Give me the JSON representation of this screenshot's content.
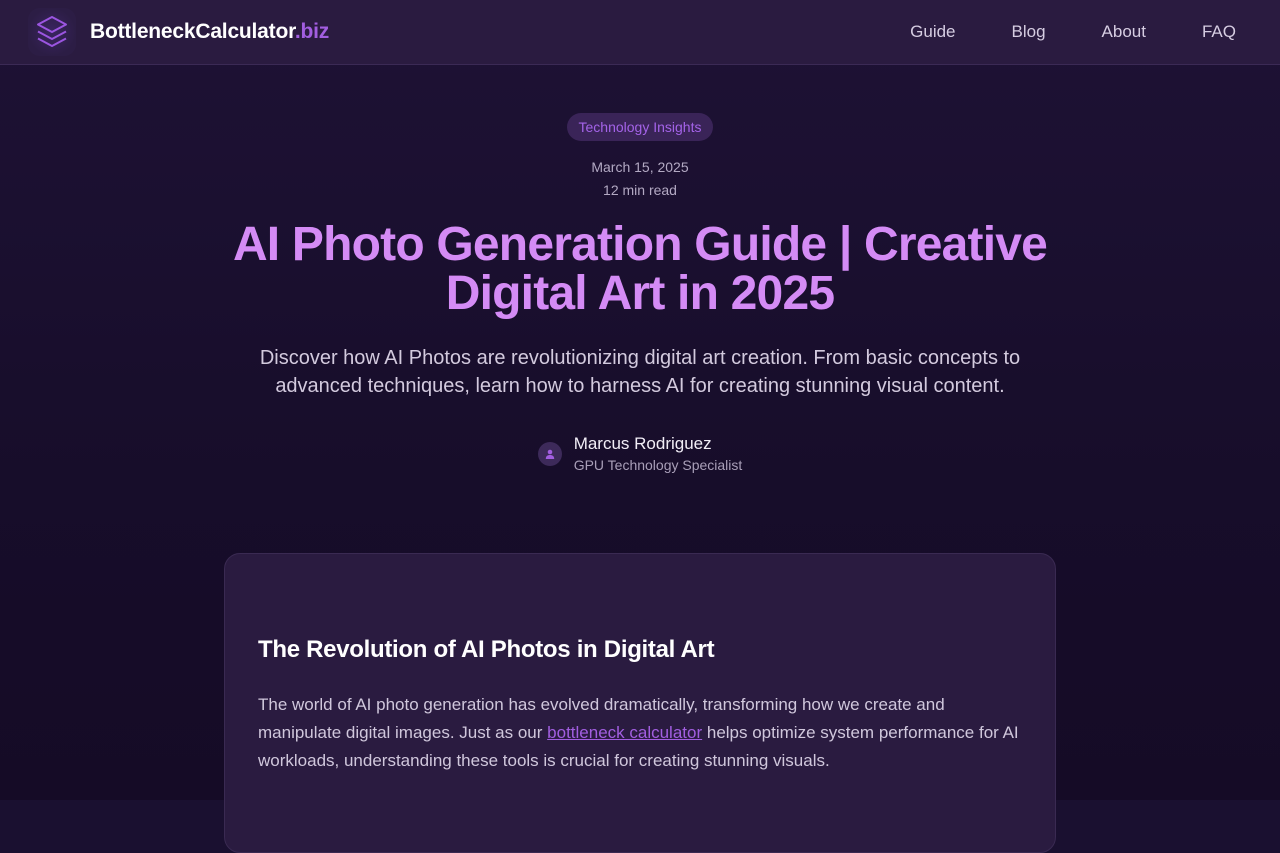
{
  "header": {
    "brand_main": "BottleneckCalculator",
    "brand_tld": ".biz",
    "logo_icon": "layers-icon",
    "nav": [
      {
        "label": "Guide"
      },
      {
        "label": "Blog"
      },
      {
        "label": "About"
      },
      {
        "label": "FAQ"
      }
    ]
  },
  "article": {
    "category": "Technology Insights",
    "date": "March 15, 2025",
    "read_time": "12 min read",
    "title": "AI Photo Generation Guide | Creative Digital Art in 2025",
    "subtitle": "Discover how AI Photos are revolutionizing digital art creation. From basic concepts to advanced techniques, learn how to harness AI for creating stunning visual content.",
    "author": {
      "name": "Marcus Rodriguez",
      "role": "GPU Technology Specialist",
      "avatar_icon": "user-icon"
    }
  },
  "content": {
    "heading": "The Revolution of AI Photos in Digital Art",
    "para_before": "The world of AI photo generation has evolved dramatically, transforming how we create and manipulate digital images. Just as our ",
    "link_text": "bottleneck calculator",
    "para_after": " helps optimize system performance for AI workloads, understanding these tools is crucial for creating stunning visuals."
  },
  "colors": {
    "accent": "#a25ee0",
    "title": "#d48bf5",
    "header_bg": "#2a1b40",
    "page_bg": "#1a1030"
  }
}
